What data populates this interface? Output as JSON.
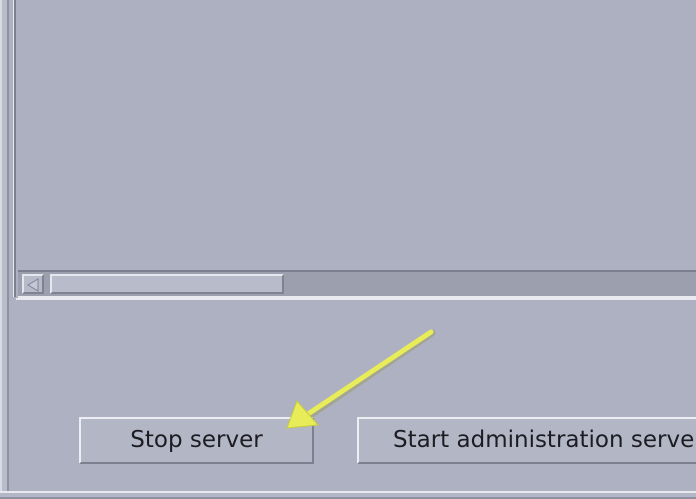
{
  "buttons": {
    "stop_server": "Stop server",
    "start_admin_server": "Start administration server"
  },
  "annotation": {
    "arrow_color": "#e8ec58",
    "icon": "pointer-arrow-icon"
  },
  "scrollbar": {
    "left_arrow_icon": "chevron-left-icon"
  },
  "colors": {
    "panel_background": "#aeb1c1",
    "text_area_background": "#adb0c1",
    "button_face": "#b3b6c5"
  }
}
